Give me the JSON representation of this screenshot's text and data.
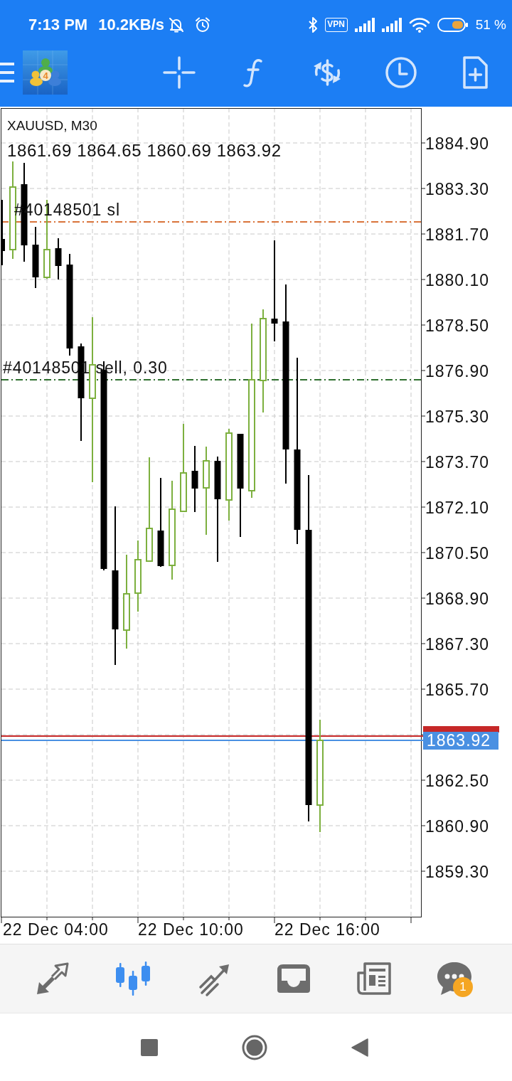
{
  "status_bar": {
    "time": "7:13 PM",
    "speed": "10.2KB/s",
    "vpn": "VPN",
    "battery": "51 %"
  },
  "toolbar": {
    "logo_text": "4"
  },
  "chart": {
    "title": "XAUUSD, M30",
    "ohlc": "1861.69 1864.65 1860.69 1863.92",
    "price_axis": [
      "1884.90",
      "1883.30",
      "1881.70",
      "1880.10",
      "1878.50",
      "1876.90",
      "1875.30",
      "1873.70",
      "1872.10",
      "1870.50",
      "1868.90",
      "1867.30",
      "1865.70",
      "1862.50",
      "1860.90",
      "1859.30"
    ],
    "time_axis": [
      "22 Dec 04:00",
      "22 Dec 10:00",
      "22 Dec 16:00"
    ],
    "order_lines": [
      {
        "label": "#40148501 sl",
        "color": "#d9733a"
      },
      {
        "label": "#40148501 sell, 0.30",
        "color": "#2f6f2f"
      }
    ],
    "price_lines": [
      {
        "color": "#c62828"
      },
      {
        "color": "#4a90e2",
        "tag": "1863.92"
      }
    ]
  },
  "bottom_nav": {
    "tabs": [
      {
        "selected": false
      },
      {
        "selected": true
      },
      {
        "selected": false
      },
      {
        "selected": false
      },
      {
        "selected": false
      },
      {
        "selected": false,
        "badge": "1"
      }
    ]
  }
}
